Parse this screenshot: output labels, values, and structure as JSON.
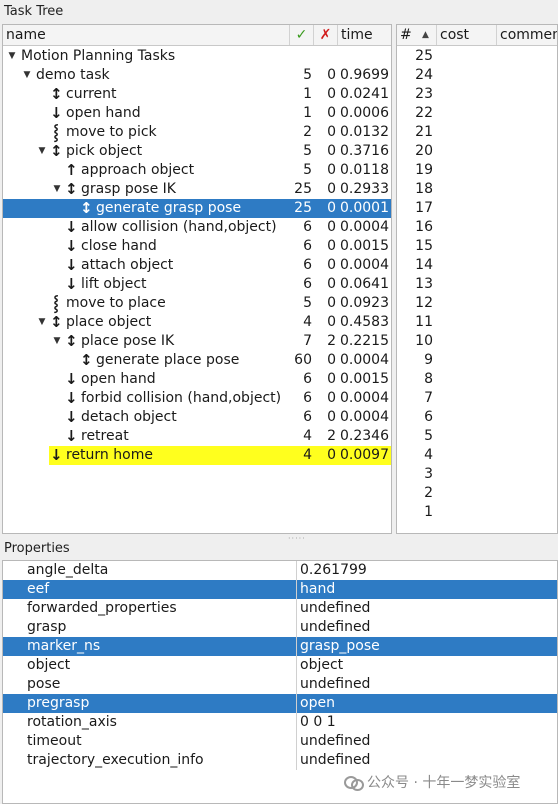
{
  "task_tree": {
    "title": "Task Tree",
    "headers": {
      "name": "name",
      "ok": "✓",
      "fail": "✗",
      "time": "time"
    },
    "rows": [
      {
        "name": "Motion Planning Tasks",
        "ok": "",
        "fail": "",
        "time": "",
        "depth": 0,
        "expander": "expanded",
        "icon": ""
      },
      {
        "name": "demo task",
        "ok": "5",
        "fail": "0",
        "time": "0.9699",
        "depth": 1,
        "expander": "expanded",
        "icon": ""
      },
      {
        "name": "current",
        "ok": "1",
        "fail": "0",
        "time": "0.0241",
        "depth": 2,
        "expander": "none",
        "icon": "bidirectional"
      },
      {
        "name": "open hand",
        "ok": "1",
        "fail": "0",
        "time": "0.0006",
        "depth": 2,
        "expander": "none",
        "icon": "forward"
      },
      {
        "name": "move to pick",
        "ok": "2",
        "fail": "0",
        "time": "0.0132",
        "depth": 2,
        "expander": "none",
        "icon": "connect"
      },
      {
        "name": "pick object",
        "ok": "5",
        "fail": "0",
        "time": "0.3716",
        "depth": 2,
        "expander": "expanded",
        "icon": "bidirectional"
      },
      {
        "name": "approach object",
        "ok": "5",
        "fail": "0",
        "time": "0.0118",
        "depth": 3,
        "expander": "none",
        "icon": "backward"
      },
      {
        "name": "grasp pose IK",
        "ok": "25",
        "fail": "0",
        "time": "0.2933",
        "depth": 3,
        "expander": "expanded",
        "icon": "bidirectional"
      },
      {
        "name": "generate grasp pose",
        "ok": "25",
        "fail": "0",
        "time": "0.0001",
        "depth": 4,
        "expander": "none",
        "icon": "bidirectional",
        "selected": true
      },
      {
        "name": "allow collision (hand,object)",
        "ok": "6",
        "fail": "0",
        "time": "0.0004",
        "depth": 3,
        "expander": "none",
        "icon": "forward"
      },
      {
        "name": "close hand",
        "ok": "6",
        "fail": "0",
        "time": "0.0015",
        "depth": 3,
        "expander": "none",
        "icon": "forward"
      },
      {
        "name": "attach object",
        "ok": "6",
        "fail": "0",
        "time": "0.0004",
        "depth": 3,
        "expander": "none",
        "icon": "forward"
      },
      {
        "name": "lift object",
        "ok": "6",
        "fail": "0",
        "time": "0.0641",
        "depth": 3,
        "expander": "none",
        "icon": "forward"
      },
      {
        "name": "move to place",
        "ok": "5",
        "fail": "0",
        "time": "0.0923",
        "depth": 2,
        "expander": "none",
        "icon": "connect"
      },
      {
        "name": "place object",
        "ok": "4",
        "fail": "0",
        "time": "0.4583",
        "depth": 2,
        "expander": "expanded",
        "icon": "bidirectional"
      },
      {
        "name": "place pose IK",
        "ok": "7",
        "fail": "2",
        "time": "0.2215",
        "depth": 3,
        "expander": "expanded",
        "icon": "bidirectional"
      },
      {
        "name": "generate place pose",
        "ok": "60",
        "fail": "0",
        "time": "0.0004",
        "depth": 4,
        "expander": "none",
        "icon": "bidirectional"
      },
      {
        "name": "open hand",
        "ok": "6",
        "fail": "0",
        "time": "0.0015",
        "depth": 3,
        "expander": "none",
        "icon": "forward"
      },
      {
        "name": "forbid collision (hand,object)",
        "ok": "6",
        "fail": "0",
        "time": "0.0004",
        "depth": 3,
        "expander": "none",
        "icon": "forward"
      },
      {
        "name": "detach object",
        "ok": "6",
        "fail": "0",
        "time": "0.0004",
        "depth": 3,
        "expander": "none",
        "icon": "forward"
      },
      {
        "name": "retreat",
        "ok": "4",
        "fail": "2",
        "time": "0.2346",
        "depth": 3,
        "expander": "none",
        "icon": "forward"
      },
      {
        "name": "return home",
        "ok": "4",
        "fail": "0",
        "time": "0.0097",
        "depth": 2,
        "expander": "none",
        "icon": "forward",
        "highlight": true
      }
    ]
  },
  "solutions": {
    "headers": {
      "index": "#",
      "cost": "cost",
      "comment": "commen"
    },
    "sort_indicator": "▲",
    "rows": [
      "25",
      "24",
      "23",
      "22",
      "21",
      "20",
      "19",
      "18",
      "17",
      "16",
      "15",
      "14",
      "13",
      "12",
      "11",
      "10",
      "9",
      "8",
      "7",
      "6",
      "5",
      "4",
      "3",
      "2",
      "1"
    ]
  },
  "properties": {
    "title": "Properties",
    "rows": [
      {
        "key": "angle_delta",
        "value": "0.261799"
      },
      {
        "key": "eef",
        "value": "hand",
        "selected": true
      },
      {
        "key": "forwarded_properties",
        "value": "undefined"
      },
      {
        "key": "grasp",
        "value": "undefined"
      },
      {
        "key": "marker_ns",
        "value": "grasp_pose",
        "selected": true
      },
      {
        "key": "object",
        "value": "object"
      },
      {
        "key": "pose",
        "value": "undefined"
      },
      {
        "key": "pregrasp",
        "value": "open",
        "selected": true
      },
      {
        "key": "rotation_axis",
        "value": "0 0 1"
      },
      {
        "key": "timeout",
        "value": "undefined"
      },
      {
        "key": "trajectory_execution_info",
        "value": "undefined"
      }
    ]
  },
  "watermark": {
    "text": "公众号 · 十年一梦实验室",
    "icon": "wechat-icon"
  },
  "colors": {
    "selection": "#2e7bc4",
    "highlight": "#ffff1e",
    "ok": "#3a9a1e",
    "fail": "#d21b1b"
  }
}
